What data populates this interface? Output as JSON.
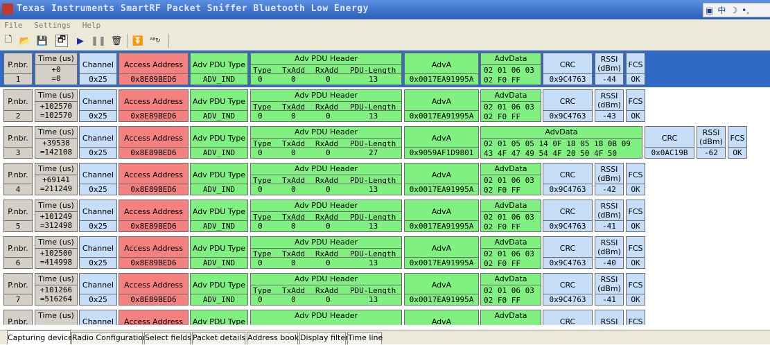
{
  "window": {
    "title": "Texas Instruments SmartRF Packet Sniffer Bluetooth Low Energy"
  },
  "ime": {
    "label": "中"
  },
  "menu": [
    "File",
    "Settings",
    "Help"
  ],
  "toolbar": {
    "icons": [
      "new-file-icon",
      "open-folder-icon",
      "save-icon",
      "open-window-icon",
      "play-icon",
      "pause-icon",
      "clear-icon",
      "scroll-down-icon",
      "ab-toggle-icon"
    ]
  },
  "labels": {
    "pnbr": "P.nbr.",
    "time": "Time (us)",
    "channel": "Channel",
    "access_address": "Access Address",
    "pdu_type": "Adv PDU Type",
    "pdu_header": "Adv PDU Header",
    "type": "Type",
    "txadd": "TxAdd",
    "rxadd": "RxAdd",
    "pdu_length": "PDU-Length",
    "adva": "AdvA",
    "advdata": "AdvData",
    "crc": "CRC",
    "rssi1": "RSSI",
    "rssi2": "(dBm)",
    "fcs": "FCS"
  },
  "packets": [
    {
      "nbr": "1",
      "t1": "+0",
      "t2": "=0",
      "channel": "0x25",
      "aa": "0x8E89BED6",
      "pdu_type": "ADV_IND",
      "type": "0",
      "txadd": "0",
      "rxadd": "0",
      "len": "13",
      "adva": "0x0017EA91995A",
      "advdata1": "02 01 06 03",
      "advdata2": "02 F0 FF",
      "crc": "0x9C4763",
      "rssi": "-44",
      "fcs": "OK"
    },
    {
      "nbr": "2",
      "t1": "+102570",
      "t2": "=102570",
      "channel": "0x25",
      "aa": "0x8E89BED6",
      "pdu_type": "ADV_IND",
      "type": "0",
      "txadd": "0",
      "rxadd": "0",
      "len": "13",
      "adva": "0x0017EA91995A",
      "advdata1": "02 01 06 03",
      "advdata2": "02 F0 FF",
      "crc": "0x9C4763",
      "rssi": "-43",
      "fcs": "OK"
    },
    {
      "nbr": "3",
      "t1": "+39538",
      "t2": "=142108",
      "channel": "0x25",
      "aa": "0x8E89BED6",
      "pdu_type": "ADV_IND",
      "type": "0",
      "txadd": "0",
      "rxadd": "0",
      "len": "27",
      "adva": "0x9059AF1D9801",
      "advdata1": "02 01 05 05 14 0F 18 05 18 0B 09",
      "advdata2": "43 4F 47 49 54 4F 20 50 4F 50",
      "crc": "0x0AC19B",
      "rssi": "-62",
      "fcs": "OK"
    },
    {
      "nbr": "4",
      "t1": "+69141",
      "t2": "=211249",
      "channel": "0x25",
      "aa": "0x8E89BED6",
      "pdu_type": "ADV_IND",
      "type": "0",
      "txadd": "0",
      "rxadd": "0",
      "len": "13",
      "adva": "0x0017EA91995A",
      "advdata1": "02 01 06 03",
      "advdata2": "02 F0 FF",
      "crc": "0x9C4763",
      "rssi": "-42",
      "fcs": "OK"
    },
    {
      "nbr": "5",
      "t1": "+101249",
      "t2": "=312498",
      "channel": "0x25",
      "aa": "0x8E89BED6",
      "pdu_type": "ADV_IND",
      "type": "0",
      "txadd": "0",
      "rxadd": "0",
      "len": "13",
      "adva": "0x0017EA91995A",
      "advdata1": "02 01 06 03",
      "advdata2": "02 F0 FF",
      "crc": "0x9C4763",
      "rssi": "-41",
      "fcs": "OK"
    },
    {
      "nbr": "6",
      "t1": "+102500",
      "t2": "=414998",
      "channel": "0x25",
      "aa": "0x8E89BED6",
      "pdu_type": "ADV_IND",
      "type": "0",
      "txadd": "0",
      "rxadd": "0",
      "len": "13",
      "adva": "0x0017EA91995A",
      "advdata1": "02 01 06 03",
      "advdata2": "02 F0 FF",
      "crc": "0x9C4763",
      "rssi": "-40",
      "fcs": "OK"
    },
    {
      "nbr": "7",
      "t1": "+101266",
      "t2": "=516264",
      "channel": "0x25",
      "aa": "0x8E89BED6",
      "pdu_type": "ADV_IND",
      "type": "0",
      "txadd": "0",
      "rxadd": "0",
      "len": "13",
      "adva": "0x0017EA91995A",
      "advdata1": "02 01 06 03",
      "advdata2": "02 F0 FF",
      "crc": "0x9C4763",
      "rssi": "-41",
      "fcs": "OK"
    }
  ],
  "tabs": [
    "Capturing device",
    "Radio Configuration",
    "Select fields",
    "Packet details",
    "Address book",
    "Display filter",
    "Time line"
  ],
  "active_tab": "Capturing device"
}
